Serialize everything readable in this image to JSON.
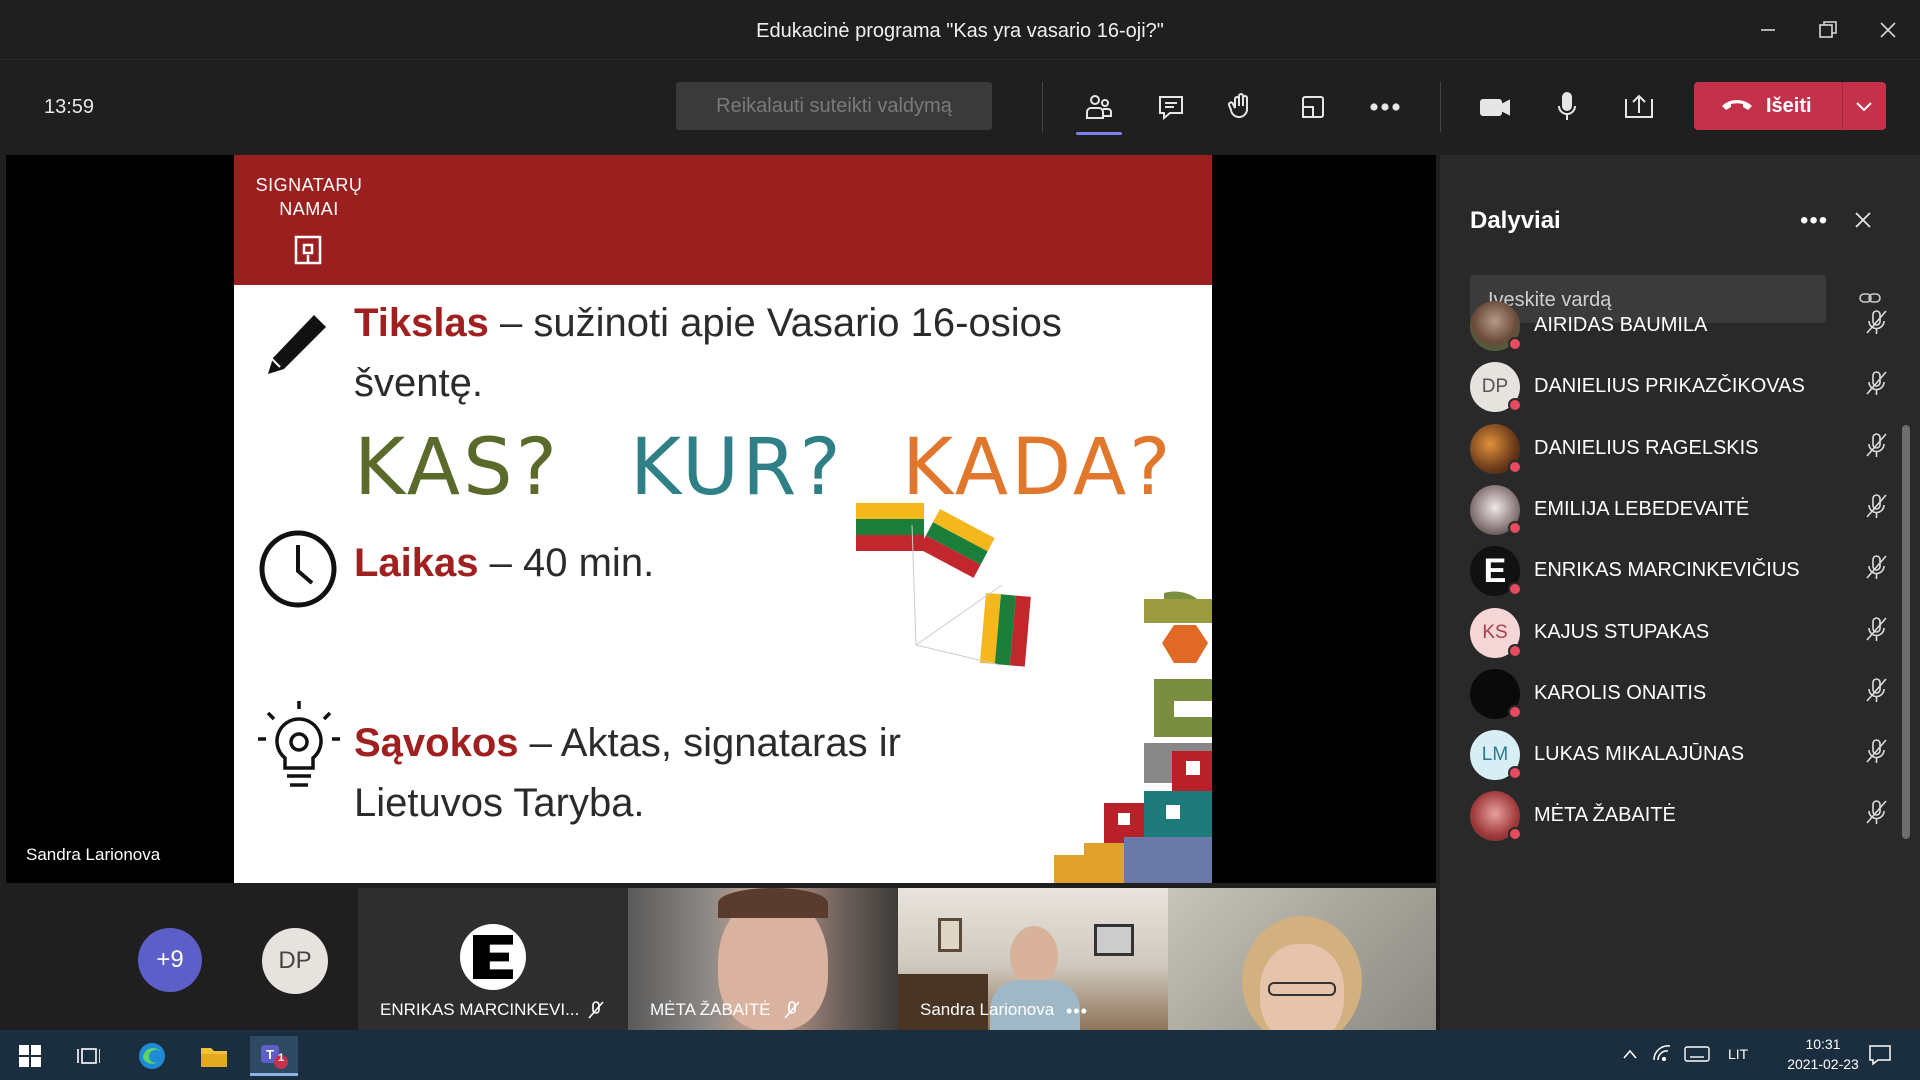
{
  "window": {
    "title": "Edukacinė programa \"Kas yra vasario 16-oji?\""
  },
  "toolbar": {
    "clock": "13:59",
    "request_control_label": "Reikalauti suteikti valdymą",
    "leave_label": "Išeiti",
    "colors": {
      "leave": "#c4314b",
      "accent": "#7b83eb"
    }
  },
  "stage": {
    "presenter_name": "Sandra Larionova",
    "slide": {
      "logo_line1": "SIGNATARŲ",
      "logo_line2": "NAMAI",
      "goal_key": "Tikslas",
      "goal_text": " – sužinoti apie Vasario 16-osios",
      "goal_text2": "šventę.",
      "kas": "KAS?",
      "kur": "KUR?",
      "kada": "KADA?",
      "time_key": "Laikas",
      "time_text": " – 40 min.",
      "concepts_key": "Sąvokos",
      "concepts_text": " – Aktas, signataras ir",
      "concepts_text2": "Lietuvos Taryba."
    }
  },
  "strip": {
    "more_count": "+9",
    "dp_initials": "DP",
    "tiles": [
      {
        "name": "ENRIKAS MARCINKEVI..."
      },
      {
        "name": "MĖTA ŽABAITĖ"
      },
      {
        "name": "Sandra Larionova"
      }
    ]
  },
  "panel": {
    "title": "Dalyviai",
    "search_placeholder": "Įveskite vardą",
    "participants": [
      {
        "name": "AIRIDAS BAUMILA",
        "initials": ""
      },
      {
        "name": "DANIELIUS PRIKAZČIKOVAS",
        "initials": "DP"
      },
      {
        "name": "DANIELIUS RAGELSKIS",
        "initials": ""
      },
      {
        "name": "EMILIJA LEBEDEVAITĖ",
        "initials": ""
      },
      {
        "name": "ENRIKAS MARCINKEVIČIUS",
        "initials": "E"
      },
      {
        "name": "KAJUS STUPAKAS",
        "initials": "KS"
      },
      {
        "name": "KAROLIS ONAITIS",
        "initials": ""
      },
      {
        "name": "LUKAS MIKALAJŪNAS",
        "initials": "LM"
      },
      {
        "name": "MĖTA ŽABAITĖ",
        "initials": ""
      }
    ]
  },
  "taskbar": {
    "teams_badge": "1",
    "language": "LIT",
    "time": "10:31",
    "date": "2021-02-23"
  }
}
